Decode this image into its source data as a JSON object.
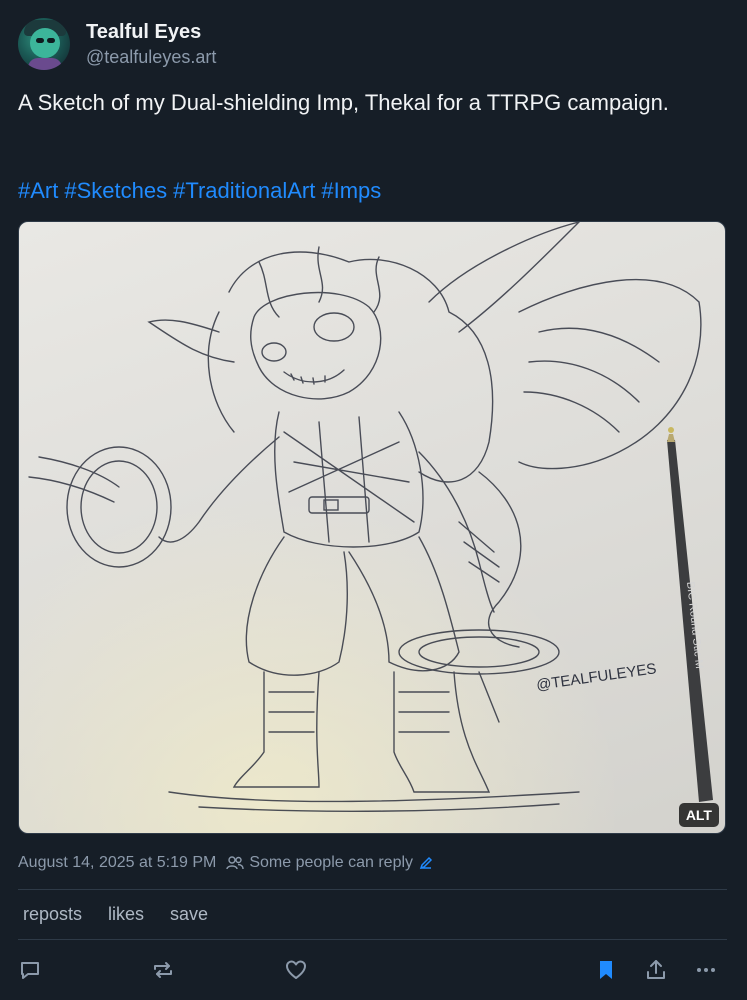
{
  "author": {
    "display_name": "Tealful Eyes",
    "handle": "@tealfuleyes.art"
  },
  "post": {
    "text": "A Sketch of my Dual-shielding Imp, Thekal for a TTRPG campaign.",
    "hashtags": [
      "#Art",
      "#Sketches",
      "#TraditionalArt",
      "#Imps"
    ],
    "image_alt_badge": "ALT",
    "image_signature": "@TEALFULEYES",
    "pen_label": "BIC Round Stic M"
  },
  "meta": {
    "timestamp": "August 14, 2025 at 5:19 PM",
    "reply_setting": "Some people can reply"
  },
  "counts": {
    "reposts": "reposts",
    "likes": "likes",
    "save": "save"
  },
  "actions": {
    "reply_icon": "reply-icon",
    "repost_icon": "repost-icon",
    "like_icon": "heart-icon",
    "bookmark_icon": "bookmark-icon",
    "share_icon": "share-icon",
    "more_icon": "more-icon"
  },
  "colors": {
    "background": "#161e27",
    "link": "#208bfe",
    "muted": "#8c9aab",
    "bookmark_active": "#208bfe"
  }
}
